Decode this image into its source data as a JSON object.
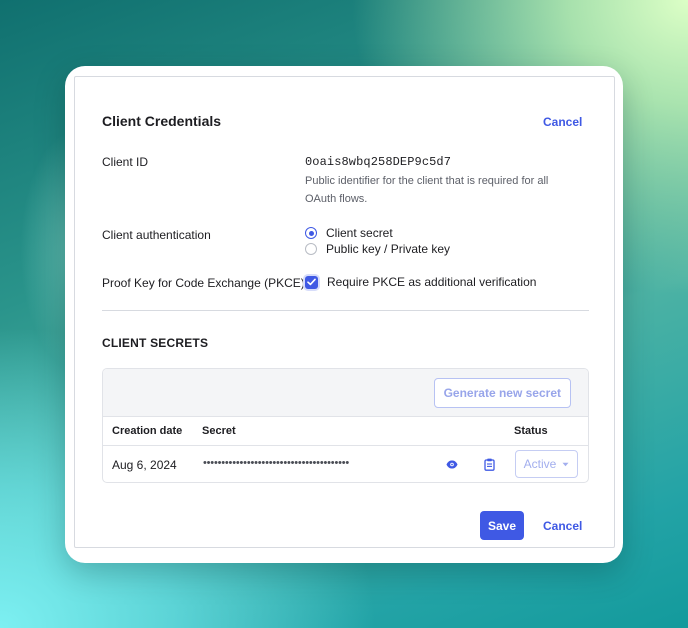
{
  "dialog": {
    "title": "Client Credentials",
    "cancel_top": "Cancel",
    "save": "Save",
    "cancel_bottom": "Cancel"
  },
  "client_id": {
    "label": "Client ID",
    "value": "0oais8wbq258DEP9c5d7",
    "help": "Public identifier for the client that is required for all OAuth flows."
  },
  "client_auth": {
    "label": "Client authentication",
    "options": [
      {
        "label": "Client secret",
        "selected": true
      },
      {
        "label": "Public key / Private key",
        "selected": false
      }
    ]
  },
  "pkce": {
    "label": "Proof Key for Code Exchange (PKCE)",
    "checkbox_label": "Require PKCE as additional verification",
    "checked": true
  },
  "secrets": {
    "section_title": "CLIENT SECRETS",
    "generate_button": "Generate new secret",
    "columns": [
      "Creation date",
      "Secret",
      "Status"
    ],
    "rows": [
      {
        "creation_date": "Aug 6, 2024",
        "secret_masked": "••••••••••••••••••••••••••••••••••••••••",
        "status": "Active"
      }
    ],
    "icons": {
      "reveal": "eye-icon",
      "copy": "clipboard-icon",
      "dropdown": "caret-down-icon"
    }
  },
  "colors": {
    "accent": "#3f59e4",
    "accent_disabled": "#98a5ea",
    "text": "#1d1d21",
    "muted": "#5c5f68",
    "border": "#d7dae0"
  }
}
